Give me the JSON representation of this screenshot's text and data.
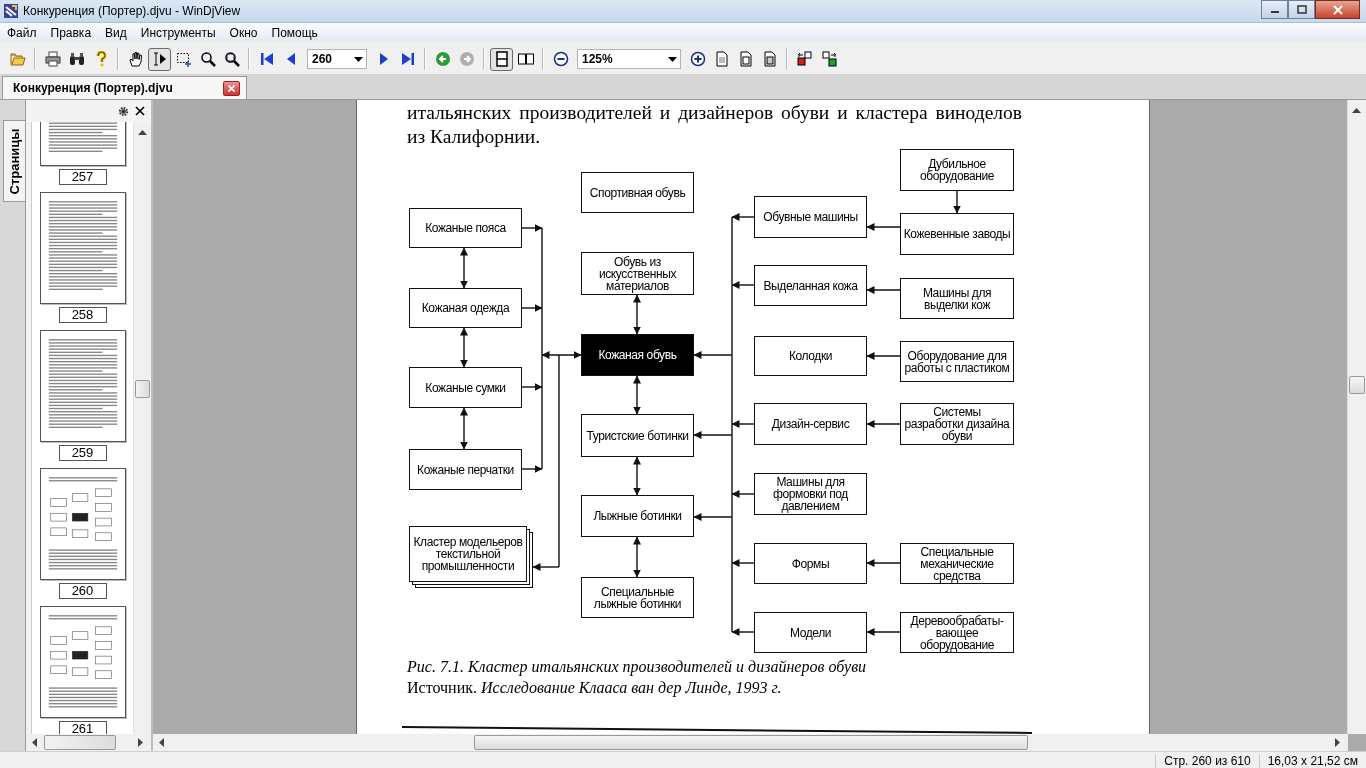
{
  "window": {
    "title": "Конкуренция (Портер).djvu - WinDjView"
  },
  "menu": [
    "Файл",
    "Правка",
    "Вид",
    "Инструменты",
    "Окно",
    "Помощь"
  ],
  "toolbar": [
    {
      "kind": "open",
      "pressed": false,
      "disabled": false
    },
    {
      "kind": "separator"
    },
    {
      "kind": "print",
      "pressed": false,
      "disabled": false
    },
    {
      "kind": "find",
      "pressed": false,
      "disabled": false
    },
    {
      "kind": "help",
      "pressed": false,
      "disabled": false
    },
    {
      "kind": "separator"
    },
    {
      "kind": "hand",
      "pressed": false,
      "disabled": false
    },
    {
      "kind": "select",
      "pressed": true,
      "disabled": false
    },
    {
      "kind": "rect-select",
      "pressed": false,
      "disabled": false
    },
    {
      "kind": "zoom",
      "pressed": false,
      "disabled": false
    },
    {
      "kind": "zoom-rect",
      "pressed": false,
      "disabled": false
    },
    {
      "kind": "separator"
    },
    {
      "kind": "first",
      "pressed": false,
      "disabled": false
    },
    {
      "kind": "prev",
      "pressed": false,
      "disabled": false
    },
    {
      "kind": "page-field",
      "value": "260"
    },
    {
      "kind": "next",
      "pressed": false,
      "disabled": false
    },
    {
      "kind": "last",
      "pressed": false,
      "disabled": false
    },
    {
      "kind": "separator"
    },
    {
      "kind": "back",
      "pressed": false,
      "disabled": false
    },
    {
      "kind": "forward",
      "pressed": false,
      "disabled": true
    },
    {
      "kind": "separator"
    },
    {
      "kind": "single",
      "pressed": true,
      "disabled": false
    },
    {
      "kind": "double",
      "pressed": false,
      "disabled": false
    },
    {
      "kind": "separator"
    },
    {
      "kind": "zoom-out",
      "pressed": false,
      "disabled": false
    },
    {
      "kind": "zoom-field",
      "value": "125%"
    },
    {
      "kind": "zoom-in",
      "pressed": false,
      "disabled": false
    },
    {
      "kind": "fit-width",
      "pressed": false,
      "disabled": false
    },
    {
      "kind": "fit-page",
      "pressed": false,
      "disabled": false
    },
    {
      "kind": "actual",
      "pressed": false,
      "disabled": false
    },
    {
      "kind": "separator"
    },
    {
      "kind": "rotate-left",
      "pressed": false,
      "disabled": false
    },
    {
      "kind": "rotate-right",
      "pressed": false,
      "disabled": false
    }
  ],
  "tabs": [
    {
      "label": "Конкуренция (Портер).djvu",
      "selected": true
    }
  ],
  "sidebar": {
    "tab": "Страницы",
    "thumbnails": [
      {
        "label": "257",
        "kind": "text"
      },
      {
        "label": "258",
        "kind": "text"
      },
      {
        "label": "259",
        "kind": "text"
      },
      {
        "label": "260",
        "kind": "diagram"
      },
      {
        "label": "261",
        "kind": "diagram"
      }
    ]
  },
  "page": {
    "text_lines": [
      "итальянских производителей и дизайнеров обуви и кластера виноделов",
      "из Калифорнии."
    ],
    "diagram": {
      "nodes": [
        {
          "label": "Кожаные пояса",
          "kind": "box"
        },
        {
          "label": "Кожаная одежда",
          "kind": "box"
        },
        {
          "label": "Кожаные сумки",
          "kind": "box"
        },
        {
          "label": "Кожаные перчатки",
          "kind": "box"
        },
        {
          "label": "Кластер модельеров текстильной промышленности",
          "kind": "stack"
        },
        {
          "label": "Спортивная обувь",
          "kind": "box"
        },
        {
          "label": "Обувь из искусственных материалов",
          "kind": "box"
        },
        {
          "label": "Кожаная обувь",
          "kind": "highlight"
        },
        {
          "label": "Туристские ботинки",
          "kind": "box"
        },
        {
          "label": "Лыжные ботинки",
          "kind": "box"
        },
        {
          "label": "Специальные лыжные ботинки",
          "kind": "box"
        },
        {
          "label": "Обувные машины",
          "kind": "box"
        },
        {
          "label": "Выделанная кожа",
          "kind": "box"
        },
        {
          "label": "Колодки",
          "kind": "box"
        },
        {
          "label": "Дизайн-сервис",
          "kind": "box"
        },
        {
          "label": "Машины для формовки под давлением",
          "kind": "box"
        },
        {
          "label": "Формы",
          "kind": "box"
        },
        {
          "label": "Модели",
          "kind": "box"
        },
        {
          "label": "Дубильное оборудование",
          "kind": "box"
        },
        {
          "label": "Кожевенные заводы",
          "kind": "box"
        },
        {
          "label": "Машины для выделки кож",
          "kind": "box"
        },
        {
          "label": "Оборудование для работы с пластиком",
          "kind": "box"
        },
        {
          "label": "Системы разработки дизайна обуви",
          "kind": "box"
        },
        {
          "label": "Специальные механические средства",
          "kind": "box"
        },
        {
          "label": "Деревообрабаты- вающее оборудование",
          "kind": "box"
        }
      ]
    },
    "caption": {
      "title": "Рис. 7.1. Кластер итальянских производителей и дизайнеров обуви",
      "source": "Источник. *Исследование Клааса ван дер Линде, 1993 г.*"
    }
  },
  "status_bar": [
    "Стр. 260 из 610",
    "16,03 x 21,52 см"
  ]
}
